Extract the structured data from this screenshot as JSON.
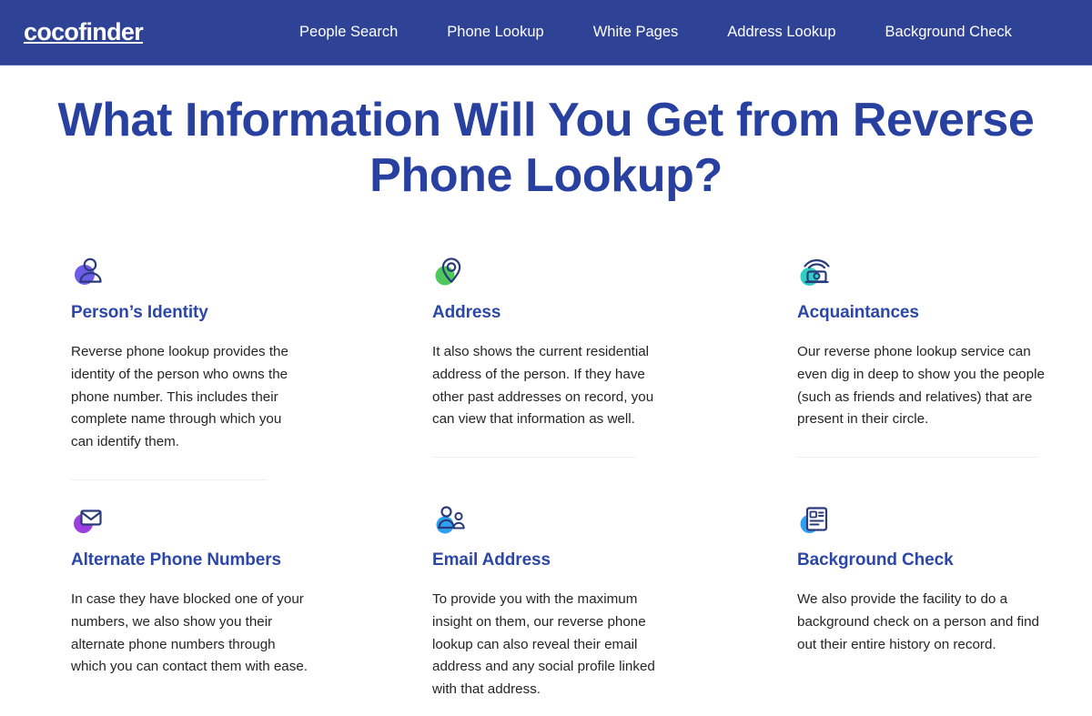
{
  "header": {
    "logo": "cocofinder",
    "nav": [
      {
        "label": "People Search"
      },
      {
        "label": "Phone Lookup"
      },
      {
        "label": "White Pages"
      },
      {
        "label": "Address Lookup"
      },
      {
        "label": "Background Check"
      }
    ],
    "background_color": "#2e4296",
    "text_color": "#ffffff"
  },
  "main": {
    "headline": "What Information Will You Get from Reverse Phone Lookup?",
    "headline_color": "#2840a0",
    "features": [
      {
        "icon": "person-identity-icon",
        "icon_accent": "#6c5ce7",
        "title": "Person’s Identity",
        "description": "Reverse phone lookup provides the identity of the person who owns the phone number. This includes their complete name through which you can identify them."
      },
      {
        "icon": "map-pin-icon",
        "icon_accent": "#4cc95a",
        "title": "Address",
        "description": "It also shows the current residential address of the person. If they have other past addresses on record, you can view that information as well."
      },
      {
        "icon": "telephone-icon",
        "icon_accent": "#2fd0c4",
        "title": "Acquaintances",
        "description": "Our reverse phone lookup service can even dig in deep to show you the people (such as friends and relatives) that are present in their circle."
      },
      {
        "icon": "envelope-icon",
        "icon_accent": "#9b3fe0",
        "title": "Alternate Phone Numbers",
        "description": "In case they have blocked one of your numbers, we also show you their alternate phone numbers through which you can contact them with ease."
      },
      {
        "icon": "two-people-icon",
        "icon_accent": "#2f9ff0",
        "title": "Email Address",
        "description": "To provide you with the maximum insight on them, our reverse phone lookup can also reveal their email address and any social profile linked with that address."
      },
      {
        "icon": "id-document-icon",
        "icon_accent": "#2f9ff0",
        "title": "Background Check",
        "description": "We also provide the facility to do a background check on a person and find out their entire history on record."
      }
    ],
    "title_color": "#2c47a8",
    "body_color": "#252525",
    "divider_color": "#eceef2"
  }
}
